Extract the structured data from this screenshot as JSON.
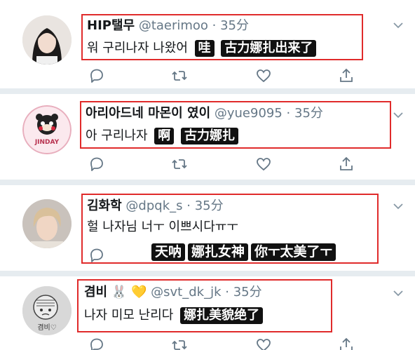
{
  "tweets": [
    {
      "name": "HIP탤무",
      "handle": "@taerimoo",
      "sep": " · ",
      "time": "35分",
      "text": "워 구리나자 나왔어",
      "subs": [
        "哇",
        "古力娜扎出来了"
      ]
    },
    {
      "name": "아리아드네 마몬이 였이",
      "handle": "@yue9095",
      "sep": " · ",
      "time": "35分",
      "text": "아 구리나자",
      "subs": [
        "啊",
        "古力娜扎"
      ],
      "avatar_caption": "JINDAY"
    },
    {
      "name": "김화학",
      "handle": "@dpqk_s",
      "sep": " · ",
      "time": "35分",
      "text": "헐 나자님 너ㅜ 이쁘시다ㅠㅜ",
      "subs": [
        "天呐",
        "娜扎女神",
        "你ㅜ太美了ㅜ"
      ]
    },
    {
      "name": "겸비",
      "emoji": "🐰 💛",
      "handle": "@svt_dk_jk",
      "sep": " · ",
      "time": "35分",
      "text": "나자 미모 난리다",
      "subs": [
        "娜扎美貌绝了"
      ],
      "avatar_caption": "겸비♡"
    }
  ],
  "icons": [
    "reply-icon",
    "retweet-icon",
    "like-icon",
    "share-icon",
    "chevron-down-icon"
  ],
  "colors": {
    "highlight": "#e02b2b",
    "separator": "#e6ecf0",
    "handle": "#657786",
    "icon": "#657786"
  }
}
